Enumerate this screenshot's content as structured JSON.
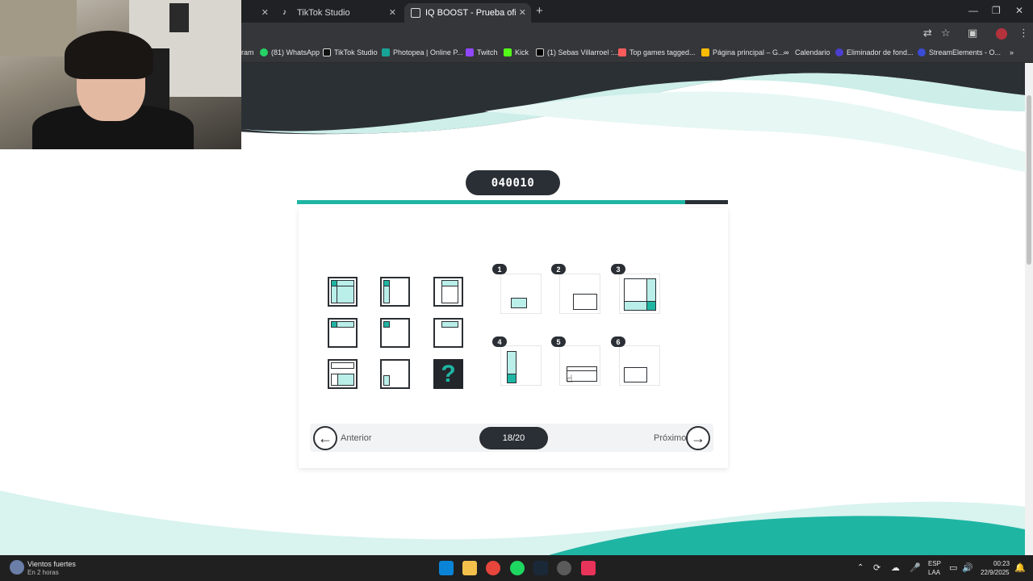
{
  "browser": {
    "tabs": [
      {
        "label": "",
        "active": false
      },
      {
        "label": "TikTok Studio",
        "active": false
      },
      {
        "label": "IQ BOOST - Prueba oficial de Cl",
        "active": true
      }
    ],
    "bookmarks": [
      {
        "label": "ram",
        "color": "#888888"
      },
      {
        "label": "(81) WhatsApp",
        "color": "#25d366"
      },
      {
        "label": "TikTok Studio",
        "color": "#ffffff"
      },
      {
        "label": "Photopea | Online P...",
        "color": "#18a497"
      },
      {
        "label": "Twitch",
        "color": "#9146ff"
      },
      {
        "label": "Kick",
        "color": "#53fc18"
      },
      {
        "label": "(1) Sebas Villarroel :...",
        "color": "#ffffff"
      },
      {
        "label": "Top games tagged...",
        "color": "#fa5c5c"
      },
      {
        "label": "Página principal – G...",
        "color": "#fbbc04"
      },
      {
        "label": "Calendario",
        "color": "#ffffff"
      },
      {
        "label": "Eliminador de fond...",
        "color": "#4b3fcf"
      },
      {
        "label": "StreamElements - O...",
        "color": "#3a4bd6"
      }
    ]
  },
  "test": {
    "code": "040010",
    "progress_fraction": 0.9,
    "counter": "18/20",
    "prev_label": "Anterior",
    "next_label": "Próximo",
    "question_mark": "?",
    "options": [
      "1",
      "2",
      "3",
      "4",
      "5",
      "6"
    ]
  },
  "taskbar": {
    "weather_title": "Vientos fuertes",
    "weather_sub": "En 2 horas",
    "lang_1": "ESP",
    "lang_2": "LAA",
    "time": "00:23",
    "date": "22/9/2025"
  },
  "colors": {
    "teal": "#1fb5a3",
    "light_teal": "#b9eee9",
    "dark": "#2a2f35"
  }
}
